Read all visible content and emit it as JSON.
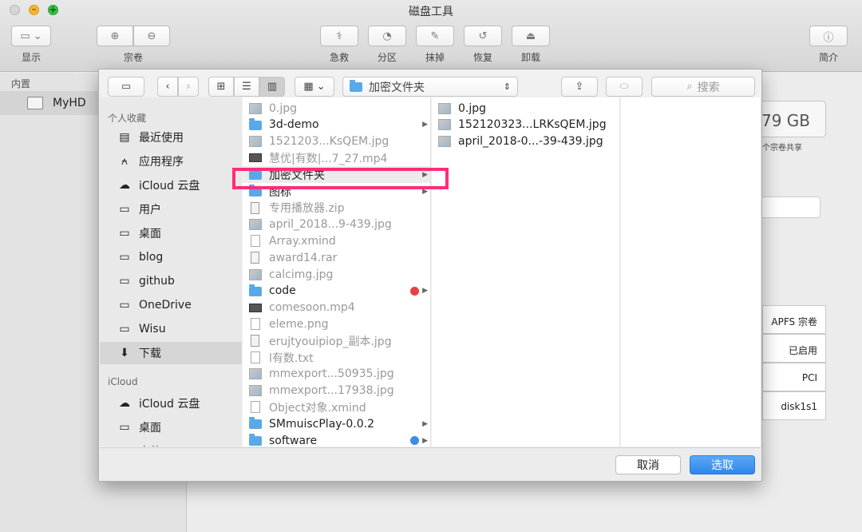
{
  "window": {
    "title": "磁盘工具"
  },
  "toolbar": {
    "view_label": "显示",
    "volume_label": "宗卷",
    "first_aid": "急救",
    "partition": "分区",
    "erase": "抹掉",
    "restore": "恢复",
    "unmount": "卸载",
    "info": "简介"
  },
  "sidebar": {
    "section": "内置",
    "items": [
      {
        "label": "MyHD"
      }
    ]
  },
  "main": {
    "capacity": "79 GB",
    "shared_note": "个宗卷共享",
    "details": [
      "APFS 宗卷",
      "已启用",
      "PCI",
      "disk1s1"
    ]
  },
  "sheet": {
    "location": "加密文件夹",
    "search_placeholder": "搜索",
    "favorites_header": "个人收藏",
    "favorites": [
      "最近使用",
      "应用程序",
      "iCloud 云盘",
      "用户",
      "桌面",
      "blog",
      "github",
      "OneDrive",
      "Wisu",
      "下载"
    ],
    "icloud_header": "iCloud",
    "icloud_items": [
      "iCloud 云盘",
      "桌面",
      "文稿"
    ],
    "column1": [
      {
        "name": "0.jpg",
        "type": "img",
        "dim": true
      },
      {
        "name": "3d-demo",
        "type": "folder",
        "dim": false,
        "arrow": true
      },
      {
        "name": "1521203...KsQEM.jpg",
        "type": "img",
        "dim": true
      },
      {
        "name": "慧优|有数|...7_27.mp4",
        "type": "vid",
        "dim": true
      },
      {
        "name": "加密文件夹",
        "type": "folder",
        "dim": false,
        "arrow": true,
        "selected": true
      },
      {
        "name": "图标",
        "type": "folder",
        "dim": false,
        "arrow": true
      },
      {
        "name": "专用播放器.zip",
        "type": "zip",
        "dim": true
      },
      {
        "name": "april_2018...9-439.jpg",
        "type": "img",
        "dim": true
      },
      {
        "name": "Array.xmind",
        "type": "doc",
        "dim": true
      },
      {
        "name": "award14.rar",
        "type": "zip",
        "dim": true
      },
      {
        "name": "calcimg.jpg",
        "type": "img",
        "dim": true
      },
      {
        "name": "code",
        "type": "folder",
        "dim": false,
        "arrow": true,
        "tag": "#e84040"
      },
      {
        "name": "comesoon.mp4",
        "type": "vid",
        "dim": true
      },
      {
        "name": "eleme.png",
        "type": "doc",
        "dim": true
      },
      {
        "name": "erujtyouipiop_副本.jpg",
        "type": "zip",
        "dim": true
      },
      {
        "name": "l有数.txt",
        "type": "doc",
        "dim": true
      },
      {
        "name": "mmexport...50935.jpg",
        "type": "img",
        "dim": true
      },
      {
        "name": "mmexport...17938.jpg",
        "type": "img",
        "dim": true
      },
      {
        "name": "Object对象.xmind",
        "type": "doc",
        "dim": true
      },
      {
        "name": "SMmuiscPlay-0.0.2",
        "type": "folder",
        "dim": false,
        "arrow": true
      },
      {
        "name": "software",
        "type": "folder",
        "dim": false,
        "arrow": true,
        "tag": "#3a8ee6"
      }
    ],
    "column2": [
      {
        "name": "0.jpg",
        "type": "img"
      },
      {
        "name": "152120323...LRKsQEM.jpg",
        "type": "img"
      },
      {
        "name": "april_2018-0...-39-439.jpg",
        "type": "img"
      }
    ],
    "cancel": "取消",
    "choose": "选取"
  },
  "colors": {
    "accent": "#3a8ee6",
    "highlight": "#ff2d7a"
  }
}
